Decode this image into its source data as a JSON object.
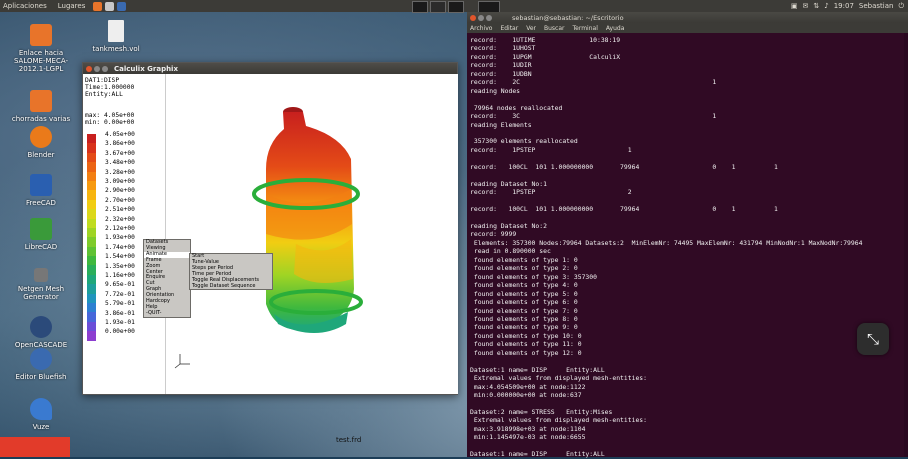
{
  "top_panel": {
    "menus": [
      "Aplicaciones",
      "Lugares"
    ],
    "time": "19:07",
    "user": "Sebastian"
  },
  "desktop_icons": [
    {
      "label": "Enlace hacia SALOME-MECA-2012.1-LGPL",
      "icon": "folder-icon",
      "color": "#e8742a"
    },
    {
      "label": "tankmesh.vol",
      "icon": "document-icon",
      "color": "#eeeeee"
    },
    {
      "label": "chorradas varias",
      "icon": "folder-icon",
      "color": "#e8742a"
    },
    {
      "label": "Blender",
      "icon": "blender-icon",
      "color": "#ea7a1a"
    },
    {
      "label": "FreeCAD",
      "icon": "freecad-icon",
      "color": "#2a5fb0"
    },
    {
      "label": "LibreCAD",
      "icon": "librecad-icon",
      "color": "#3a9a3a"
    },
    {
      "label": "Netgen Mesh Generator",
      "icon": "netgen-icon",
      "color": "#777777"
    },
    {
      "label": "OpenCASCADE",
      "icon": "opencascade-icon",
      "color": "#2b4a7a"
    },
    {
      "label": "Editor Bluefish",
      "icon": "bluefish-icon",
      "color": "#3a6ab0"
    },
    {
      "label": "Vuze",
      "icon": "vuze-icon",
      "color": "#3a7ad0"
    }
  ],
  "cgx": {
    "title": "Calculix Graphix",
    "info": "DAT1:DISP\nTime:1.000000\nEntity:ALL",
    "max": "max: 4.05e+00",
    "min": "min: 0.00e+00",
    "legend_values": [
      "4.05e+00",
      "3.86e+00",
      "3.67e+00",
      "3.48e+00",
      "3.28e+00",
      "3.09e+00",
      "2.90e+00",
      "2.70e+00",
      "2.51e+00",
      "2.32e+00",
      "2.12e+00",
      "1.93e+00",
      "1.74e+00",
      "1.54e+00",
      "1.35e+00",
      "1.16e+00",
      "9.65e-01",
      "7.72e-01",
      "5.79e-01",
      "3.86e-01",
      "1.93e-01",
      "0.00e+00"
    ],
    "legend_colors": [
      "#c8201e",
      "#d8321b",
      "#e44b17",
      "#ec6414",
      "#f37f12",
      "#f79a10",
      "#f7b50f",
      "#f1cd12",
      "#dcd81a",
      "#c0dc1f",
      "#9fd424",
      "#7fcb2b",
      "#5fc234",
      "#3fb83e",
      "#2aae5a",
      "#1fa77a",
      "#1e9f9b",
      "#2095bd",
      "#2d80d2",
      "#4767da",
      "#6a4ed8",
      "#8c3ed0"
    ],
    "context_menu": [
      "Datasets",
      "Viewing",
      "Animate",
      "Frame",
      "Zoom",
      "Center",
      "Enquire",
      "Cut",
      "Graph",
      "Orientation",
      "Hardcopy",
      "Help",
      "-QUIT-"
    ],
    "submenu": [
      "Start",
      "Tune-Value",
      "Steps per Period",
      "Time per Period",
      "Toggle Real Displacements",
      "Toggle Dataset Sequence"
    ],
    "filename": "test.frd"
  },
  "terminal": {
    "title": "sebastian@sebastian: ~/Escritorio",
    "menu": [
      "Archivo",
      "Editar",
      "Ver",
      "Buscar",
      "Terminal",
      "Ayuda"
    ],
    "lines": [
      "record:    1UTIME              10:38:19",
      "record:    1UHOST",
      "record:    1UPGM               CalculiX",
      "record:    1UDIR",
      "record:    1UDBN",
      "record:    2C                                                  1",
      "reading Nodes",
      "",
      " 79964 nodes reallocated",
      "record:    3C                                                  1",
      "reading Elements",
      "",
      " 357300 elements reallocated",
      "record:    1PSTEP                        1",
      "",
      "record:   100CL  101 1.000000000       79964                   0    1          1",
      "",
      "reading Dataset No:1",
      "record:    1PSTEP                        2",
      "",
      "record:   100CL  101 1.000000000       79964                   0    1          1",
      "",
      "reading Dataset No:2",
      "record: 9999",
      " Elements: 357300 Nodes:79964 Datasets:2  MinElemNr: 74495 MaxElemNr: 431794 MinNodNr:1 MaxNodNr:79964",
      " read in 0.890000 sec",
      " found elements of type 1: 0",
      " found elements of type 2: 0",
      " found elements of type 3: 357300",
      " found elements of type 4: 0",
      " found elements of type 5: 0",
      " found elements of type 6: 0",
      " found elements of type 7: 0",
      " found elements of type 8: 0",
      " found elements of type 9: 0",
      " found elements of type 10: 0",
      " found elements of type 11: 0",
      " found elements of type 12: 0",
      "",
      "Dataset:1 name= DISP     Entity:ALL",
      " Extremal values from displayed mesh-entities:",
      " max:4.054509e+00 at node:1122",
      " min:0.000000e+00 at node:637",
      "",
      "Dataset:2 name= STRESS   Entity:Mises",
      " Extremal values from displayed mesh-entities:",
      " max:3.918998e+03 at node:1104",
      " min:1.145497e-03 at node:6655",
      "",
      "Dataset:1 name= DISP     Entity:ALL"
    ]
  }
}
